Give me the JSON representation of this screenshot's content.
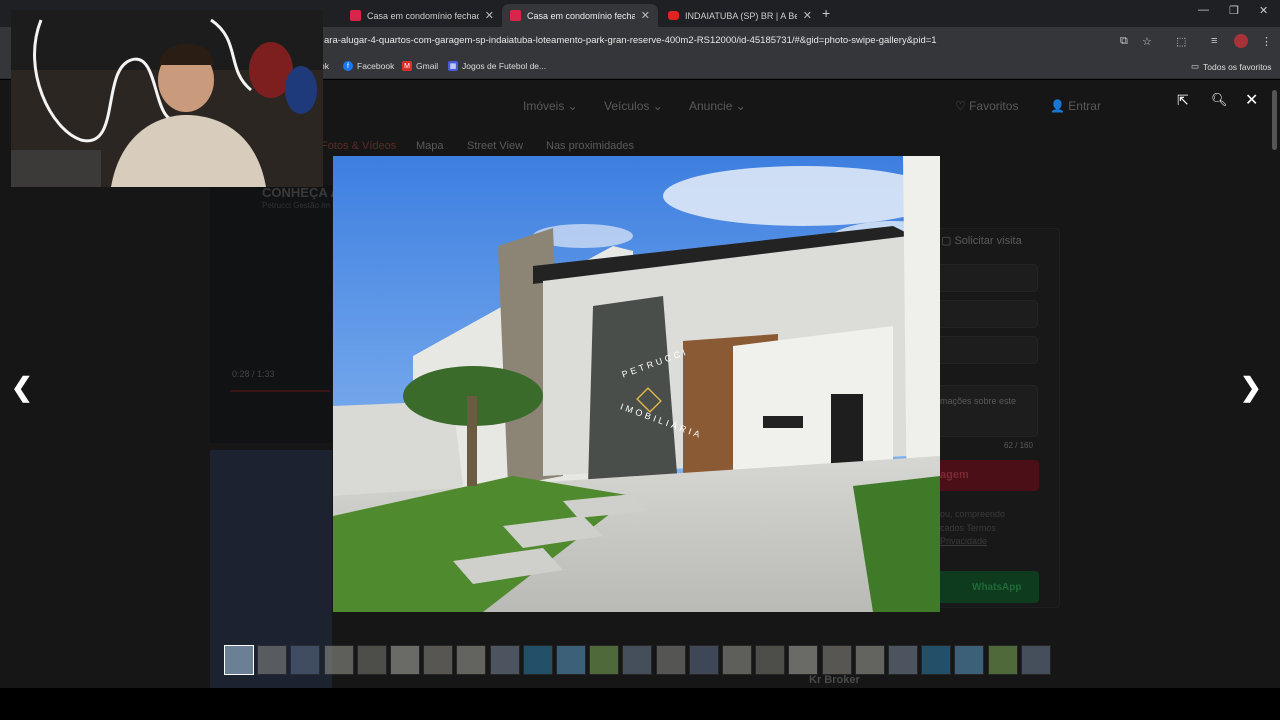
{
  "browser": {
    "tabs": [
      {
        "title": "Casa em condomínio fechado",
        "icon": "zap-imoveis-icon",
        "active": false
      },
      {
        "title": "Casa em condomínio fechado",
        "icon": "zap-imoveis-icon",
        "active": true
      },
      {
        "title": "INDAIATUBA (SP) BR | A Bela Ci",
        "icon": "youtube-icon",
        "active": false
      }
    ],
    "new_tab": "+",
    "url": "ara-alugar-4-quartos-com-garagem-sp-indaiatuba-loteamento-park-gran-reserve-400m2-RS12000/id-45185731/#&gid=photo-swipe-gallery&pid=1",
    "bookmarks": [
      {
        "label": "ok",
        "icon": ""
      },
      {
        "label": "Facebook",
        "icon": "facebook-icon"
      },
      {
        "label": "Gmail",
        "icon": "gmail-icon"
      },
      {
        "label": "Jogos de Futebol de...",
        "icon": "games-icon"
      }
    ],
    "all_bookmarks": "Todos os favoritos"
  },
  "site_nav": {
    "items": [
      "Imóveis",
      "Veículos",
      "Anuncie"
    ],
    "favorites": "Favoritos",
    "login": "Entrar"
  },
  "listing_tabs": [
    "Fotos & Vídeos",
    "Mapa",
    "Street View",
    "Nas proximidades"
  ],
  "background": {
    "video_title": "CONHEÇA A",
    "video_channel": "Petrucci Gestão Im",
    "video_time": "0:28 / 1:33",
    "request_visit": "Solicitar visita",
    "message_hint": "mações sobre este",
    "char_count": "62 / 160",
    "send_button": "agem",
    "legal_line1": "ou, compreendo",
    "legal_line2": "cados Termos",
    "legal_line3": "Privacidade",
    "whatsapp": "WhatsApp",
    "broker": "Kr Broker"
  },
  "photo": {
    "watermark_top": "PETRUCCI",
    "watermark_bottom": "IMOBILIÁRIA"
  },
  "gallery": {
    "current": 1,
    "thumbnail_count": 25
  },
  "colors": {
    "accent_red": "#d8254a",
    "whatsapp_green": "#25d366"
  }
}
